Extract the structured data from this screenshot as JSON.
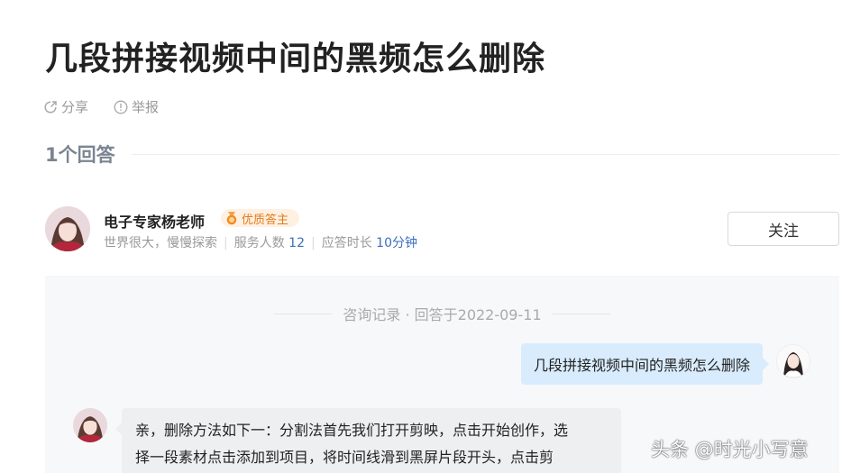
{
  "question": {
    "title": "几段拼接视频中间的黑频怎么删除"
  },
  "actions": {
    "share_label": "分享",
    "report_label": "举报"
  },
  "answers": {
    "count_label": "1个回答"
  },
  "expert": {
    "name": "电子专家杨老师",
    "badge": "优质答主",
    "motto": "世界很大，慢慢探索",
    "served_label": "服务人数",
    "served_count": "12",
    "response_label": "应答时长",
    "response_time": "10分钟",
    "follow_label": "关注"
  },
  "chat": {
    "record_label": "咨询记录 · 回答于2022-09-11",
    "question_text": "几段拼接视频中间的黑频怎么删除",
    "answer_line1": "亲，删除方法如下一：分割法首先我们打开剪映，点击开始创作，选",
    "answer_line2": "择一段素材点击添加到项目，将时间线滑到黑屏片段开头，点击剪"
  },
  "watermark": "头条 @时光小写意",
  "colors": {
    "badge_bg": "#fff1e2",
    "badge_text": "#e27a1e",
    "link_blue": "#3a6fbf",
    "question_bubble": "#d9ecfd",
    "chat_bg": "#f7f8fa"
  }
}
